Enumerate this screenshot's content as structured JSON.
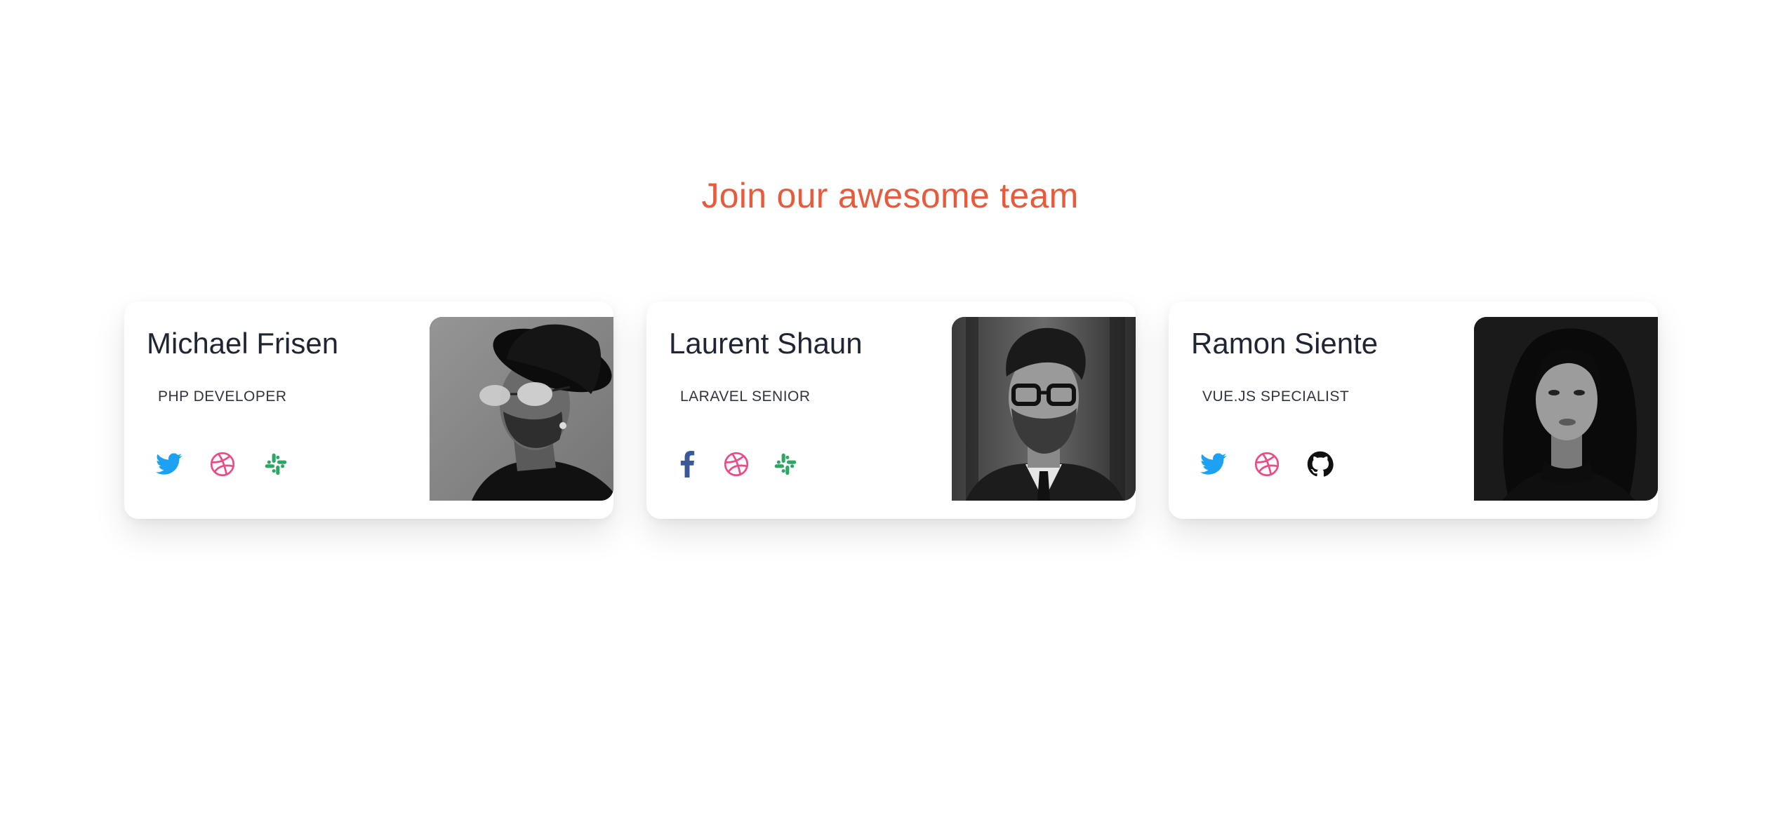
{
  "section": {
    "title": "Join our awesome team"
  },
  "colors": {
    "title": "#e85a3c",
    "twitter": "#1da1f2",
    "dribbble": "#ea4c89",
    "slack": "#2ea664",
    "facebook": "#3b5998",
    "github": "#111111"
  },
  "team": [
    {
      "name": "Michael Frisen",
      "role": "PHP DEVELOPER",
      "socials": [
        "twitter-icon",
        "dribbble-icon",
        "slack-icon"
      ],
      "photo": "man-with-hat-and-sunglasses-photo"
    },
    {
      "name": "Laurent Shaun",
      "role": "LARAVEL SENIOR",
      "socials": [
        "facebook-icon",
        "dribbble-icon",
        "slack-icon"
      ],
      "photo": "man-with-glasses-photo"
    },
    {
      "name": "Ramon Siente",
      "role": "VUE.JS SPECIALIST",
      "socials": [
        "twitter-icon",
        "dribbble-icon",
        "github-icon"
      ],
      "photo": "woman-portrait-photo"
    }
  ]
}
